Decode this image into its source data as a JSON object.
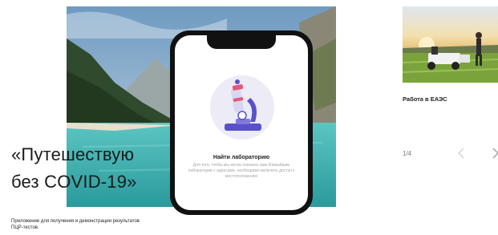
{
  "hero": {
    "headline_line1": "«Путешествую",
    "headline_line2": "без COVID-19»",
    "subtitle": "Приложение для получения и демонстрации результатов ПЦР-тестов."
  },
  "phone_screen": {
    "title": "Найти лабораторию",
    "text": "Для того, чтобы мы могли показать вам ближайшие лаборатории с адресами, необходимо включить доступ к местоположению",
    "illustration_icon": "microscope-icon"
  },
  "side_card": {
    "title": "Работа в ЕАЭС"
  },
  "pager": {
    "counter": "1/4",
    "prev_icon": "chevron-left-icon",
    "next_icon": "chevron-right-icon"
  },
  "colors": {
    "lake": "#3fb7b4",
    "sky": "#8fb8d4",
    "text": "#1a1a1a",
    "muted": "#a4a4a4",
    "illustration_purple": "#5a50c9"
  }
}
